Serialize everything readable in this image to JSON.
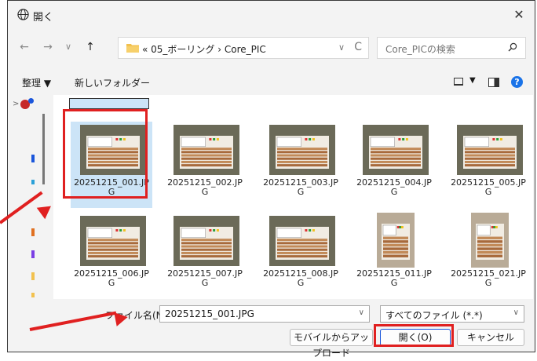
{
  "window": {
    "title": "開く",
    "close": "✕"
  },
  "nav": {
    "back": "←",
    "forward": "→",
    "history": "∨",
    "up": "↑",
    "address": "« 05_ボーリング › Core_PIC",
    "dropdown": "∨",
    "refresh": "C",
    "search_placeholder": "Core_PICの検索"
  },
  "toolbar": {
    "organize": "整理 ▼",
    "new_folder": "新しいフォルダー",
    "view_dropdown": "▼",
    "help": "?"
  },
  "sidebar": {
    "expand": ">"
  },
  "files": [
    {
      "name": "20251215_001.JPG",
      "selected": true,
      "orientation": "landscape"
    },
    {
      "name": "20251215_002.JPG",
      "selected": false,
      "orientation": "landscape"
    },
    {
      "name": "20251215_003.JPG",
      "selected": false,
      "orientation": "landscape"
    },
    {
      "name": "20251215_004.JPG",
      "selected": false,
      "orientation": "landscape"
    },
    {
      "name": "20251215_005.JPG",
      "selected": false,
      "orientation": "landscape"
    },
    {
      "name": "20251215_006.JPG",
      "selected": false,
      "orientation": "landscape"
    },
    {
      "name": "20251215_007.JPG",
      "selected": false,
      "orientation": "landscape"
    },
    {
      "name": "20251215_008.JPG",
      "selected": false,
      "orientation": "landscape"
    },
    {
      "name": "20251215_011.JPG",
      "selected": false,
      "orientation": "portrait"
    },
    {
      "name": "20251215_021.JPG",
      "selected": false,
      "orientation": "portrait"
    }
  ],
  "bottom": {
    "filename_label": "ファイル名(N):",
    "filename_value": "20251215_001.JPG",
    "filename_drop": "∨",
    "filetype_value": "すべてのファイル (*.*)",
    "filetype_drop": "∨",
    "upload_button": "モバイルからアップロード",
    "open_button": "開く(O)",
    "cancel_button": "キャンセル"
  },
  "colors": {
    "annotation": "#e02020",
    "selection": "#cce4f7",
    "help": "#1a73e8"
  }
}
